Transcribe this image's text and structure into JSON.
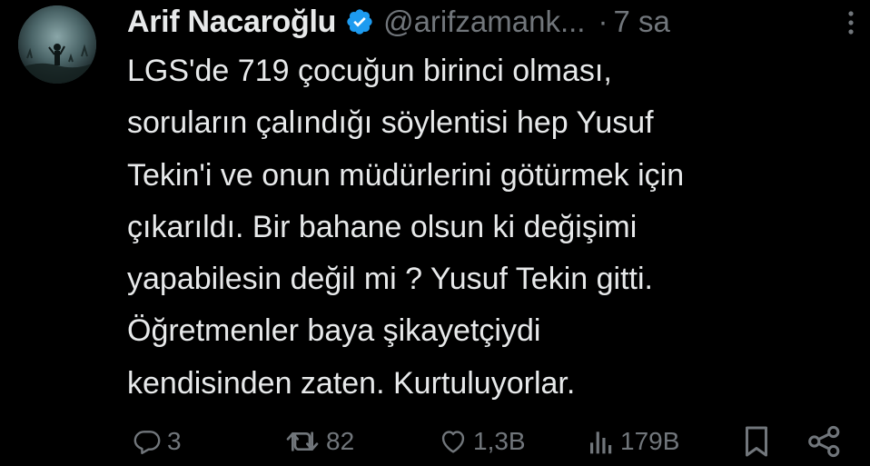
{
  "tweet": {
    "author": {
      "display_name": "Arif Nacaroğlu",
      "handle": "@arifzamank...",
      "verified": true,
      "avatar_icon": "profile-avatar"
    },
    "separator": "·",
    "time": "7 sa",
    "text_lines": [
      "LGS'de 719 çocuğun birinci olması,",
      "soruların çalındığı söylentisi hep Yusuf",
      "Tekin'i ve onun müdürlerini götürmek için",
      "çıkarıldı. Bir bahane olsun ki değişimi",
      "yapabilesin değil mi ? Yusuf Tekin gitti.",
      "Öğretmenler baya şikayetçiydi",
      "kendisinden zaten. Kurtuluyorlar."
    ],
    "actions": {
      "replies": "3",
      "retweets": "82",
      "likes": "1,3B",
      "views": "179B"
    },
    "colors": {
      "background": "#000000",
      "text": "#e7e9ea",
      "muted": "#71767b",
      "verified_badge": "#1d9bf0"
    }
  }
}
